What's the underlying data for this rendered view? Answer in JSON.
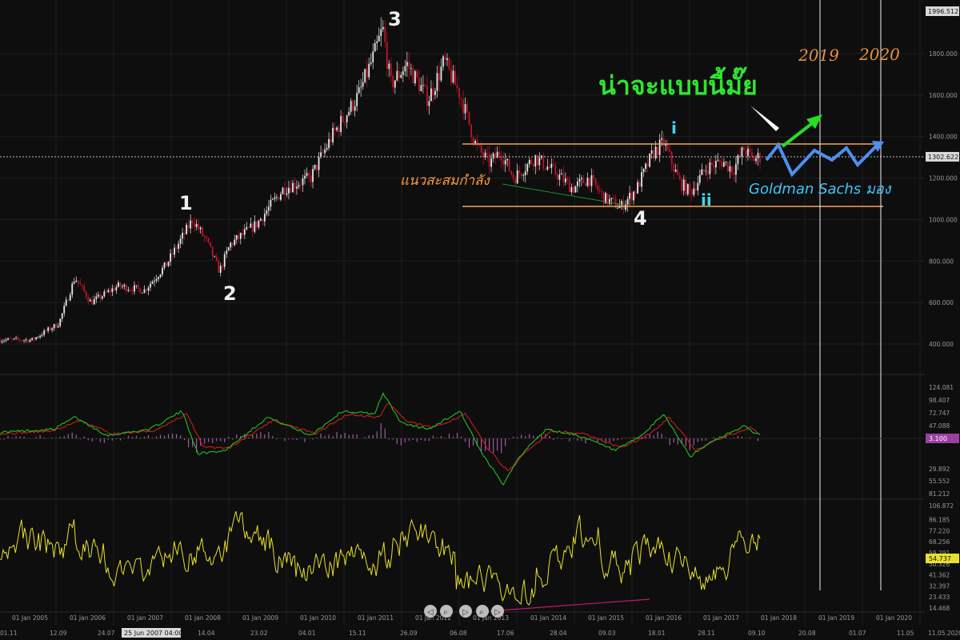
{
  "chart_data": {
    "type": "candlestick",
    "price_axis": {
      "ticks": [
        "1800.000",
        "1600.000",
        "1400.000",
        "1200.000",
        "1000.000",
        "800.000",
        "600.000",
        "400.000"
      ],
      "top_box": "1996.512",
      "current_box": "1302.622",
      "ylim": [
        250,
        2000
      ]
    },
    "x_dates": [
      "01 Jan 2005",
      "01 Jan 2006",
      "01 Jan 2007",
      "01 Jan 2008",
      "01 Jan 2009",
      "01 Jan 2010",
      "01 Jan 2011",
      "01 Jan 2012",
      "01 Jan 2013",
      "01 Jan 2014",
      "01 Jan 2015",
      "01 Jan 2016",
      "01 Jan 2017",
      "01 Jan 2018",
      "01 Jan 2019",
      "01 Jan 2020"
    ],
    "x_bottom": [
      "01.11",
      "12.09",
      "24.07",
      "25 Jun 2007 04:00:00",
      "14.04",
      "23.02",
      "04.01",
      "15.11",
      "26.09",
      "06.08",
      "17.06",
      "28.04",
      "09.03",
      "18.01",
      "28.11",
      "09.10",
      "20.08",
      "01.07",
      "11.05",
      "11.05.2020"
    ],
    "price_path": [
      [
        0,
        420
      ],
      [
        0.06,
        420
      ],
      [
        0.11,
        500
      ],
      [
        0.14,
        720
      ],
      [
        0.17,
        600
      ],
      [
        0.22,
        680
      ],
      [
        0.27,
        660
      ],
      [
        0.31,
        780
      ],
      [
        0.36,
        1000
      ],
      [
        0.385,
        900
      ],
      [
        0.41,
        750
      ],
      [
        0.43,
        880
      ],
      [
        0.48,
        980
      ],
      [
        0.53,
        1150
      ],
      [
        0.58,
        1200
      ],
      [
        0.62,
        1400
      ],
      [
        0.67,
        1600
      ],
      [
        0.7,
        1800
      ],
      [
        0.715,
        1920
      ],
      [
        0.73,
        1650
      ],
      [
        0.76,
        1750
      ],
      [
        0.8,
        1580
      ],
      [
        0.83,
        1760
      ],
      [
        0.86,
        1600
      ],
      [
        0.89,
        1350
      ],
      [
        0.915,
        1270
      ],
      [
        0.935,
        1330
      ],
      [
        0.96,
        1200
      ],
      [
        1.0,
        1300
      ],
      [
        1.04,
        1220
      ],
      [
        1.07,
        1150
      ],
      [
        1.1,
        1200
      ],
      [
        1.13,
        1100
      ],
      [
        1.16,
        1060
      ],
      [
        1.19,
        1150
      ],
      [
        1.22,
        1320
      ],
      [
        1.24,
        1370
      ],
      [
        1.27,
        1180
      ],
      [
        1.29,
        1130
      ],
      [
        1.32,
        1250
      ],
      [
        1.35,
        1280
      ],
      [
        1.37,
        1240
      ],
      [
        1.39,
        1340
      ],
      [
        1.405,
        1290
      ],
      [
        1.42,
        1302
      ]
    ],
    "indicator1": {
      "ticks": [
        "124.081",
        "98.407",
        "72.747",
        "47.088",
        "21.428",
        "3.100",
        "29.892",
        "55.552",
        "81.212",
        "106.872"
      ],
      "current": "3.100",
      "green_path": [
        [
          0,
          0.2
        ],
        [
          0.1,
          0.3
        ],
        [
          0.14,
          0.7
        ],
        [
          0.2,
          0.1
        ],
        [
          0.28,
          0.3
        ],
        [
          0.34,
          0.9
        ],
        [
          0.37,
          -0.5
        ],
        [
          0.42,
          -0.4
        ],
        [
          0.5,
          0.7
        ],
        [
          0.58,
          0.1
        ],
        [
          0.64,
          0.9
        ],
        [
          0.7,
          0.8
        ],
        [
          0.715,
          1.5
        ],
        [
          0.75,
          0.5
        ],
        [
          0.8,
          0.3
        ],
        [
          0.86,
          0.9
        ],
        [
          0.9,
          -0.5
        ],
        [
          0.94,
          -1.5
        ],
        [
          0.97,
          -0.6
        ],
        [
          1.02,
          0.3
        ],
        [
          1.08,
          0.1
        ],
        [
          1.15,
          -0.4
        ],
        [
          1.2,
          0.1
        ],
        [
          1.24,
          0.8
        ],
        [
          1.29,
          -0.6
        ],
        [
          1.33,
          -0.1
        ],
        [
          1.39,
          0.4
        ],
        [
          1.42,
          0.1
        ]
      ],
      "red_path": [
        [
          0,
          0.15
        ],
        [
          0.1,
          0.25
        ],
        [
          0.15,
          0.6
        ],
        [
          0.21,
          0.15
        ],
        [
          0.29,
          0.25
        ],
        [
          0.35,
          0.8
        ],
        [
          0.38,
          -0.3
        ],
        [
          0.43,
          -0.3
        ],
        [
          0.51,
          0.6
        ],
        [
          0.59,
          0.15
        ],
        [
          0.65,
          0.8
        ],
        [
          0.71,
          0.7
        ],
        [
          0.725,
          1.2
        ],
        [
          0.76,
          0.55
        ],
        [
          0.81,
          0.35
        ],
        [
          0.87,
          0.8
        ],
        [
          0.91,
          -0.3
        ],
        [
          0.95,
          -1.1
        ],
        [
          0.98,
          -0.5
        ],
        [
          1.03,
          0.25
        ],
        [
          1.09,
          0.15
        ],
        [
          1.16,
          -0.3
        ],
        [
          1.21,
          0.1
        ],
        [
          1.25,
          0.7
        ],
        [
          1.3,
          -0.4
        ],
        [
          1.34,
          -0.05
        ],
        [
          1.4,
          0.35
        ],
        [
          1.42,
          0.15
        ]
      ]
    },
    "indicator2": {
      "ticks": [
        "86.185",
        "77.220",
        "68.256",
        "59.291",
        "50.326",
        "41.362",
        "32.397",
        "23.433",
        "14.468"
      ],
      "current": "54.737",
      "ylim": [
        14.468,
        95
      ]
    },
    "annotations": {
      "wave_labels": [
        "1",
        "2",
        "3",
        "4",
        "i",
        "ii"
      ],
      "years": [
        "2019",
        "2020"
      ],
      "thai_title": "น่าจะแบบนี้มั๊ย",
      "accum_label": "แนวสะสมกำลัง",
      "gs_label": "Goldman Sachs มอง"
    },
    "colors": {
      "background": "#0e0e0e",
      "bull": "#e8e8e8",
      "bear": "#c0152a",
      "resistance_line": "#f3a35a",
      "macd_green": "#1fc21f",
      "macd_red": "#d01a1a",
      "macd_hist": "#a35aa8",
      "osc": "#e8e02a",
      "proj_green": "#22e022",
      "proj_blue": "#4f8ff0"
    }
  }
}
